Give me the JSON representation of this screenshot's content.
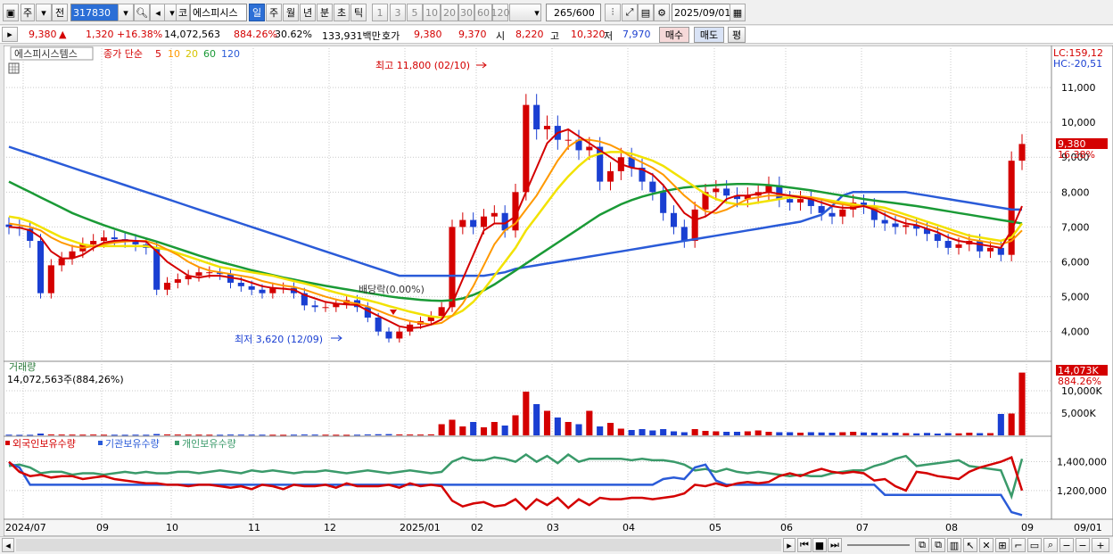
{
  "toolbar": {
    "period_btn": "주",
    "prev_btn": "전",
    "code": "317830",
    "name": "에스피시스",
    "cat": "코",
    "intervals": [
      "일",
      "주",
      "월",
      "년",
      "분",
      "초",
      "틱"
    ],
    "active_interval": 0,
    "nums": [
      "1",
      "3",
      "5",
      "10",
      "20",
      "30",
      "60",
      "120"
    ],
    "count": "265",
    "total": "/600",
    "date": "2025/09/01"
  },
  "quote": {
    "price": "9,380",
    "arrow": "▲",
    "change": "1,320",
    "pct": "+16.38%",
    "volume": "14,072,563",
    "vol_pct": "884.26%",
    "turnover": "30.62%",
    "amount": "133,931백만",
    "ho_label": "호가",
    "ask": "9,380",
    "bid": "9,370",
    "open_label": "시",
    "open": "8,220",
    "high_label": "고",
    "high": "10,320",
    "low_label": "저",
    "low": "7,970",
    "buy": "매수",
    "sell": "매도",
    "eval": "평"
  },
  "legend": {
    "name": "에스피시스템스",
    "ma_label": "종가 단순",
    "periods": [
      "5",
      "10",
      "20",
      "60",
      "120"
    ],
    "volume_title": "거래량",
    "volume_value": "14,072,563주(884,26%)",
    "holdings": [
      "외국인보유수량",
      "기관보유수량",
      "개인보유수량"
    ]
  },
  "annotations": {
    "high": "최고 11,800 (02/10)",
    "low": "최저 3,620 (12/09)",
    "dividend": "배당락(0.00%)",
    "lc": "LC:159,12",
    "hc": "HC:-20,51",
    "last_price": "9,380",
    "last_pct": "16.38%",
    "last_vol": "14,073K",
    "last_vol_pct": "884.26%"
  },
  "colors": {
    "up": "#d40000",
    "down": "#1a3fd2",
    "ma5": "#d40000",
    "ma10": "#ff9900",
    "ma20": "#f2e200",
    "ma60": "#1a9a36",
    "ma120": "#2a5bd8",
    "foreign": "#d40000",
    "institution": "#2a5bd8",
    "individual": "#3a9a6a"
  },
  "chart_data": {
    "type": "candlestick",
    "price_axis": [
      "11,000",
      "10,000",
      "9,000",
      "8,000",
      "7,000",
      "6,000",
      "5,000",
      "4,000"
    ],
    "price_range": [
      3300,
      12000
    ],
    "volume_axis": [
      "10,000K",
      "5,000K"
    ],
    "volume_range": [
      0,
      15000
    ],
    "holding_axis": [
      "1,400,000",
      "1,200,000"
    ],
    "holding_range": [
      1020000,
      1490000
    ],
    "x_axis": [
      "2024/07",
      "09",
      "10",
      "11",
      "12",
      "2025/01",
      "02",
      "03",
      "04",
      "05",
      "06",
      "07",
      "08",
      "09",
      "09/01"
    ],
    "x_positions": [
      22,
      110,
      188,
      280,
      365,
      450,
      530,
      615,
      700,
      797,
      877,
      962,
      1062,
      1147,
      1200
    ],
    "closes": [
      7000,
      6950,
      6600,
      5100,
      5900,
      6100,
      6300,
      6500,
      6600,
      6700,
      6650,
      6600,
      6500,
      6400,
      5200,
      5400,
      5500,
      5600,
      5700,
      5700,
      5650,
      5400,
      5300,
      5200,
      5100,
      5250,
      5250,
      5100,
      4750,
      4700,
      4700,
      4800,
      4900,
      4700,
      4400,
      4000,
      3800,
      4000,
      4200,
      4300,
      4450,
      4700,
      7000,
      7200,
      7000,
      7300,
      7400,
      6900,
      8000,
      10500,
      9800,
      9900,
      9500,
      9500,
      9200,
      9300,
      8300,
      8600,
      9000,
      8700,
      8300,
      8000,
      7400,
      7000,
      6600,
      7500,
      8000,
      8100,
      7900,
      7800,
      7900,
      8000,
      8200,
      7800,
      7700,
      7800,
      7600,
      7400,
      7300,
      7500,
      7700,
      7600,
      7200,
      7100,
      7000,
      7050,
      6950,
      6800,
      6600,
      6400,
      6500,
      6600,
      6300,
      6400,
      6200,
      8900,
      9380
    ],
    "volumes": [
      150,
      120,
      130,
      400,
      200,
      180,
      170,
      160,
      180,
      150,
      140,
      130,
      150,
      140,
      300,
      200,
      180,
      170,
      160,
      150,
      140,
      180,
      170,
      160,
      150,
      140,
      130,
      160,
      190,
      170,
      150,
      140,
      130,
      150,
      200,
      250,
      280,
      200,
      190,
      180,
      220,
      2500,
      3500,
      2000,
      3000,
      1800,
      3000,
      2200,
      4500,
      9800,
      7000,
      5500,
      4000,
      3000,
      2500,
      5500,
      2000,
      2800,
      1500,
      1200,
      1400,
      1100,
      1400,
      900,
      700,
      1400,
      1000,
      900,
      800,
      800,
      900,
      1100,
      800,
      700,
      700,
      600,
      700,
      650,
      600,
      700,
      800,
      650,
      600,
      550,
      600,
      500,
      450,
      550,
      400,
      500,
      450,
      600,
      500,
      500,
      4800,
      4900,
      14073
    ],
    "ma5": [
      7000,
      6980,
      6900,
      6700,
      6300,
      6100,
      6100,
      6200,
      6400,
      6550,
      6600,
      6620,
      6600,
      6580,
      6300,
      6000,
      5800,
      5600,
      5550,
      5600,
      5600,
      5550,
      5500,
      5400,
      5300,
      5250,
      5230,
      5200,
      5050,
      4950,
      4850,
      4800,
      4780,
      4760,
      4600,
      4450,
      4300,
      4150,
      4100,
      4120,
      4200,
      4350,
      4800,
      5500,
      6200,
      6900,
      7100,
      7100,
      7300,
      8000,
      8700,
      9400,
      9700,
      9800,
      9600,
      9400,
      9200,
      9000,
      8800,
      8700,
      8650,
      8500,
      8200,
      7800,
      7400,
      7200,
      7300,
      7500,
      7800,
      7900,
      7900,
      7950,
      8000,
      7950,
      7900,
      7850,
      7800,
      7700,
      7600,
      7550,
      7550,
      7600,
      7500,
      7350,
      7200,
      7100,
      7050,
      6950,
      6850,
      6700,
      6600,
      6550,
      6500,
      6450,
      6400,
      6900,
      7600
    ],
    "ma10": [
      7100,
      7050,
      7000,
      6900,
      6700,
      6550,
      6450,
      6400,
      6450,
      6500,
      6550,
      6580,
      6600,
      6600,
      6500,
      6350,
      6200,
      6000,
      5850,
      5750,
      5700,
      5650,
      5600,
      5550,
      5450,
      5380,
      5320,
      5280,
      5200,
      5100,
      5000,
      4920,
      4850,
      4800,
      4720,
      4600,
      4480,
      4380,
      4300,
      4250,
      4200,
      4250,
      4450,
      4800,
      5300,
      5900,
      6500,
      6900,
      7100,
      7500,
      7900,
      8400,
      8900,
      9300,
      9500,
      9500,
      9450,
      9350,
      9200,
      9000,
      8850,
      8700,
      8500,
      8200,
      7900,
      7650,
      7450,
      7400,
      7500,
      7650,
      7800,
      7850,
      7900,
      7900,
      7900,
      7880,
      7850,
      7780,
      7700,
      7650,
      7600,
      7600,
      7550,
      7450,
      7350,
      7250,
      7150,
      7050,
      6950,
      6850,
      6750,
      6650,
      6600,
      6550,
      6500,
      6600,
      6900
    ],
    "ma20": [
      7300,
      7250,
      7150,
      7000,
      6850,
      6700,
      6600,
      6500,
      6450,
      6450,
      6450,
      6450,
      6450,
      6450,
      6400,
      6350,
      6250,
      6150,
      6050,
      5950,
      5850,
      5800,
      5750,
      5700,
      5650,
      5600,
      5520,
      5450,
      5380,
      5300,
      5200,
      5120,
      5040,
      4970,
      4900,
      4820,
      4730,
      4650,
      4570,
      4500,
      4430,
      4400,
      4450,
      4600,
      4850,
      5200,
      5600,
      6000,
      6400,
      6900,
      7300,
      7700,
      8100,
      8450,
      8750,
      9000,
      9100,
      9150,
      9150,
      9100,
      9000,
      8900,
      8750,
      8550,
      8350,
      8150,
      7950,
      7800,
      7700,
      7650,
      7650,
      7700,
      7750,
      7800,
      7850,
      7850,
      7850,
      7800,
      7750,
      7700,
      7650,
      7600,
      7600,
      7550,
      7450,
      7350,
      7250,
      7150,
      7050,
      6950,
      6850,
      6750,
      6700,
      6650,
      6600,
      6700,
      7100
    ],
    "ma60": [
      8300,
      8150,
      8000,
      7850,
      7700,
      7550,
      7400,
      7280,
      7160,
      7050,
      6950,
      6850,
      6760,
      6670,
      6580,
      6480,
      6380,
      6280,
      6180,
      6090,
      6000,
      5920,
      5840,
      5760,
      5690,
      5620,
      5550,
      5490,
      5430,
      5370,
      5310,
      5260,
      5210,
      5160,
      5110,
      5060,
      5010,
      4970,
      4940,
      4910,
      4890,
      4880,
      4900,
      4950,
      5050,
      5180,
      5350,
      5550,
      5750,
      5950,
      6150,
      6350,
      6550,
      6750,
      6950,
      7150,
      7350,
      7500,
      7650,
      7770,
      7870,
      7950,
      8020,
      8080,
      8130,
      8160,
      8180,
      8200,
      8220,
      8230,
      8230,
      8220,
      8200,
      8170,
      8130,
      8090,
      8050,
      8000,
      7950,
      7900,
      7850,
      7800,
      7760,
      7720,
      7680,
      7640,
      7600,
      7550,
      7500,
      7450,
      7400,
      7350,
      7300,
      7250,
      7200,
      7150,
      7100
    ],
    "ma120": [
      9300,
      9200,
      9100,
      9000,
      8900,
      8800,
      8700,
      8600,
      8500,
      8400,
      8300,
      8200,
      8100,
      8000,
      7900,
      7800,
      7700,
      7600,
      7500,
      7400,
      7300,
      7200,
      7100,
      7000,
      6900,
      6800,
      6700,
      6600,
      6500,
      6400,
      6300,
      6200,
      6100,
      6000,
      5900,
      5800,
      5700,
      5600,
      5600,
      5600,
      5600,
      5600,
      5600,
      5600,
      5600,
      5600,
      5650,
      5700,
      5800,
      5850,
      5900,
      5950,
      6000,
      6050,
      6100,
      6150,
      6200,
      6250,
      6300,
      6350,
      6400,
      6450,
      6500,
      6550,
      6600,
      6650,
      6700,
      6750,
      6800,
      6850,
      6900,
      6950,
      7000,
      7050,
      7100,
      7150,
      7250,
      7350,
      7600,
      7900,
      8000,
      8000,
      8000,
      8000,
      8000,
      8000,
      7950,
      7900,
      7850,
      7800,
      7750,
      7700,
      7650,
      7600,
      7550,
      7500,
      7500
    ],
    "foreign": [
      1400000,
      1330000,
      1300000,
      1310000,
      1290000,
      1300000,
      1300000,
      1280000,
      1290000,
      1300000,
      1280000,
      1270000,
      1260000,
      1250000,
      1250000,
      1240000,
      1240000,
      1230000,
      1240000,
      1240000,
      1230000,
      1220000,
      1230000,
      1210000,
      1240000,
      1230000,
      1210000,
      1240000,
      1230000,
      1230000,
      1240000,
      1220000,
      1250000,
      1230000,
      1230000,
      1230000,
      1240000,
      1220000,
      1250000,
      1230000,
      1240000,
      1230000,
      1130000,
      1090000,
      1110000,
      1120000,
      1090000,
      1100000,
      1140000,
      1070000,
      1140000,
      1100000,
      1150000,
      1080000,
      1140000,
      1100000,
      1150000,
      1140000,
      1140000,
      1150000,
      1150000,
      1140000,
      1150000,
      1160000,
      1180000,
      1240000,
      1230000,
      1250000,
      1230000,
      1250000,
      1260000,
      1250000,
      1260000,
      1300000,
      1320000,
      1300000,
      1330000,
      1350000,
      1330000,
      1320000,
      1330000,
      1320000,
      1270000,
      1280000,
      1230000,
      1200000,
      1330000,
      1320000,
      1300000,
      1290000,
      1280000,
      1330000,
      1360000,
      1380000,
      1400000,
      1430000,
      1200000
    ],
    "institution": [
      1390000,
      1360000,
      1240000,
      1240000,
      1240000,
      1240000,
      1240000,
      1240000,
      1240000,
      1240000,
      1240000,
      1240000,
      1240000,
      1240000,
      1240000,
      1240000,
      1240000,
      1240000,
      1240000,
      1240000,
      1240000,
      1240000,
      1240000,
      1240000,
      1240000,
      1240000,
      1240000,
      1240000,
      1240000,
      1240000,
      1240000,
      1240000,
      1240000,
      1240000,
      1240000,
      1240000,
      1240000,
      1240000,
      1240000,
      1240000,
      1240000,
      1240000,
      1240000,
      1240000,
      1240000,
      1240000,
      1240000,
      1240000,
      1240000,
      1240000,
      1240000,
      1240000,
      1240000,
      1240000,
      1240000,
      1240000,
      1240000,
      1240000,
      1240000,
      1240000,
      1240000,
      1240000,
      1280000,
      1290000,
      1280000,
      1360000,
      1380000,
      1270000,
      1240000,
      1240000,
      1240000,
      1240000,
      1240000,
      1240000,
      1240000,
      1240000,
      1240000,
      1240000,
      1240000,
      1240000,
      1240000,
      1240000,
      1240000,
      1170000,
      1170000,
      1170000,
      1170000,
      1170000,
      1170000,
      1170000,
      1170000,
      1170000,
      1170000,
      1170000,
      1170000,
      1050000,
      1030000
    ],
    "individual": [
      1370000,
      1380000,
      1360000,
      1320000,
      1330000,
      1330000,
      1310000,
      1320000,
      1320000,
      1310000,
      1320000,
      1330000,
      1320000,
      1330000,
      1320000,
      1320000,
      1330000,
      1330000,
      1320000,
      1330000,
      1340000,
      1330000,
      1320000,
      1340000,
      1330000,
      1340000,
      1330000,
      1320000,
      1330000,
      1330000,
      1340000,
      1330000,
      1320000,
      1330000,
      1340000,
      1330000,
      1320000,
      1330000,
      1340000,
      1330000,
      1320000,
      1330000,
      1400000,
      1430000,
      1410000,
      1410000,
      1430000,
      1420000,
      1400000,
      1450000,
      1400000,
      1440000,
      1390000,
      1450000,
      1400000,
      1420000,
      1420000,
      1420000,
      1420000,
      1410000,
      1420000,
      1410000,
      1410000,
      1400000,
      1380000,
      1340000,
      1350000,
      1330000,
      1350000,
      1330000,
      1320000,
      1330000,
      1320000,
      1310000,
      1300000,
      1310000,
      1300000,
      1300000,
      1320000,
      1330000,
      1340000,
      1340000,
      1370000,
      1390000,
      1420000,
      1440000,
      1370000,
      1380000,
      1390000,
      1400000,
      1410000,
      1370000,
      1360000,
      1350000,
      1340000,
      1160000,
      1420000
    ]
  }
}
